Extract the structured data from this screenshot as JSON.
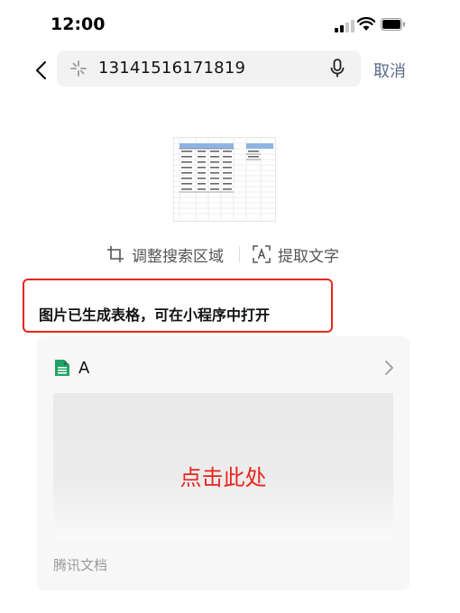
{
  "status_bar": {
    "time": "12:00"
  },
  "search": {
    "query": "13141516171819",
    "cancel_label": "取消"
  },
  "actions": {
    "adjust_label": "调整搜索区域",
    "ocr_label": "提取文字"
  },
  "notice": {
    "text": "图片已生成表格，可在小程序中打开"
  },
  "doc_card": {
    "name": "A",
    "preview_label": "点击此处",
    "source": "腾讯文档",
    "icon": "sheet-icon",
    "icon_color": "#21a366"
  },
  "colors": {
    "accent_red": "#e8261e",
    "cancel_blue": "#5b6b8c"
  }
}
